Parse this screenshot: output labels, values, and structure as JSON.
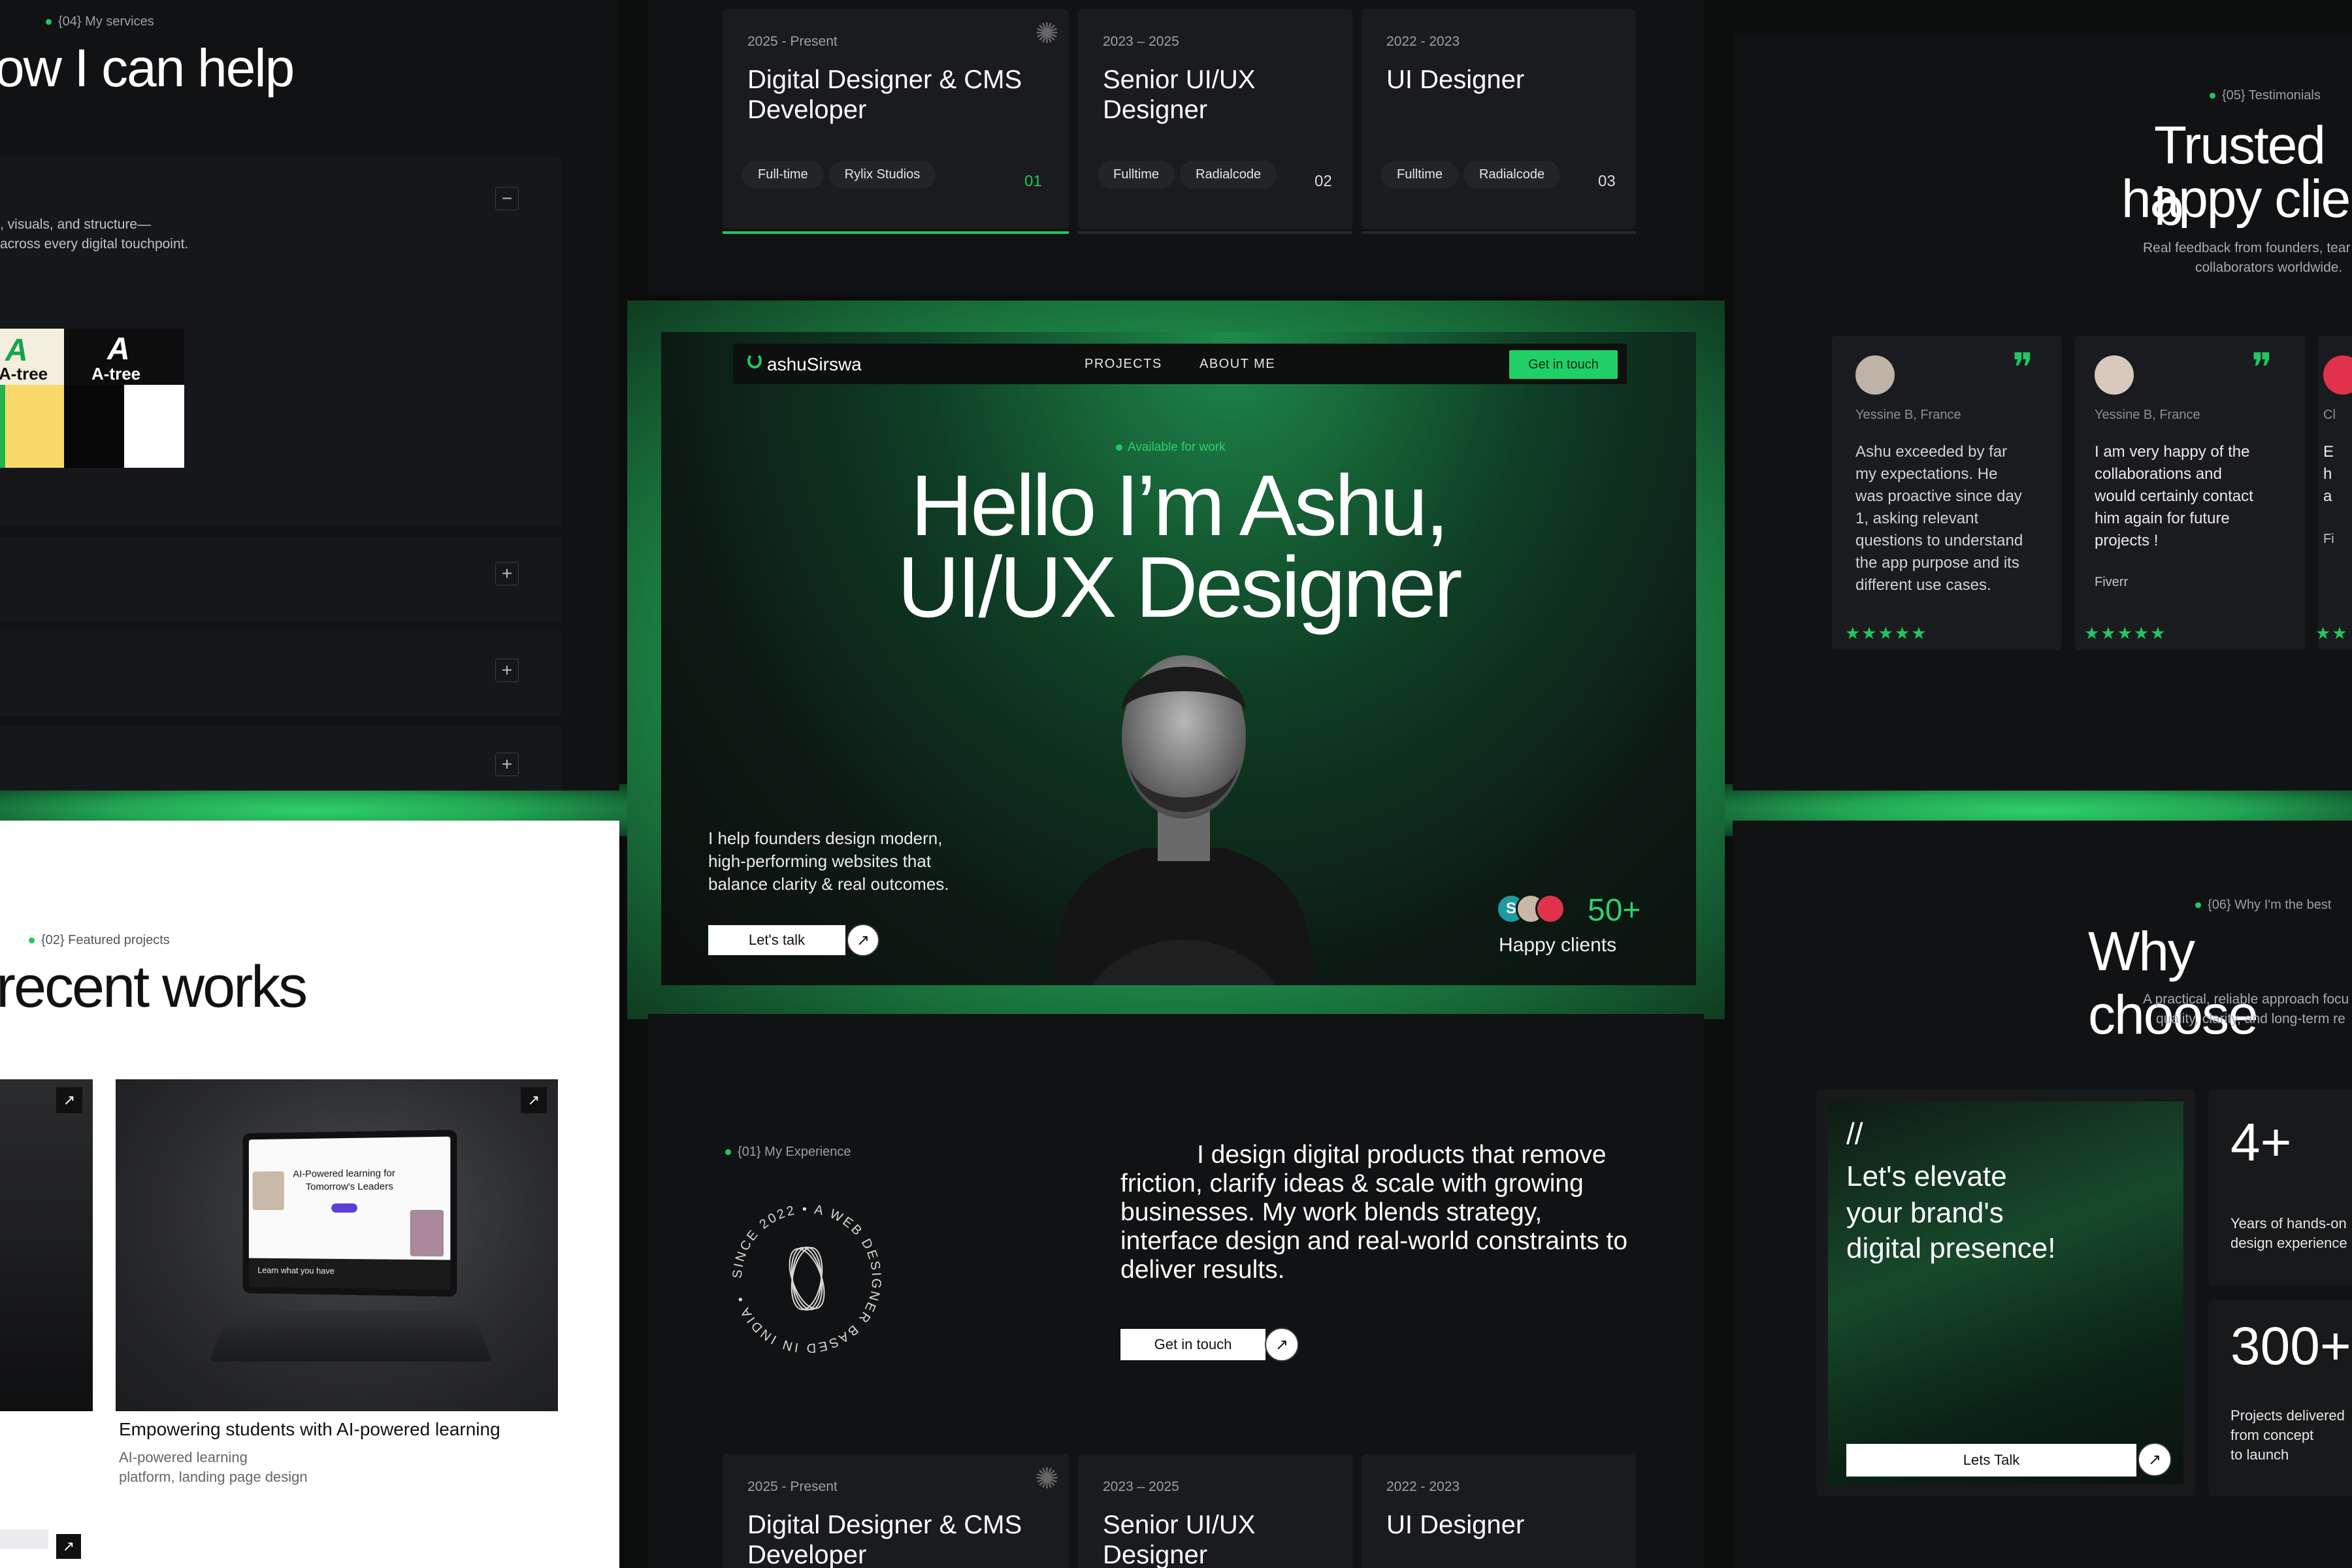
{
  "services": {
    "tag": "{04} My services",
    "title": "ow I can help",
    "desc_line1": ", visuals, and structure—",
    "desc_line2": "across every digital touchpoint.",
    "minus": "−",
    "plus": "+",
    "logo_a_label": "A-tree",
    "logo_b_label": "A-tree"
  },
  "experience_top": [
    {
      "period": "2025 - Present",
      "title_l1": "Digital Designer & CMS",
      "title_l2": "Developer",
      "chip1": "Full-time",
      "chip2": "Rylix Studios",
      "num": "01"
    },
    {
      "period": "2023 – 2025",
      "title_l1": "Senior UI/UX",
      "title_l2": "Designer",
      "chip1": "Fulltime",
      "chip2": "Radialcode",
      "num": "02"
    },
    {
      "period": "2022 - 2023",
      "title_l1": "UI Designer",
      "title_l2": "",
      "chip1": "Fulltime",
      "chip2": "Radialcode",
      "num": "03"
    }
  ],
  "experience_bottom": [
    {
      "period": "2025 - Present",
      "title_l1": "Digital Designer & CMS",
      "title_l2": "Developer"
    },
    {
      "period": "2023 – 2025",
      "title_l1": "Senior UI/UX",
      "title_l2": "Designer"
    },
    {
      "period": "2022 - 2023",
      "title_l1": "UI Designer",
      "title_l2": ""
    }
  ],
  "hero": {
    "brand": "ashuSirswa",
    "nav_projects": "PROJECTS",
    "nav_about": "ABOUT ME",
    "cta": "Get in touch",
    "available": "Available for work",
    "title_l1": "Hello I’m Ashu,",
    "title_l2": "UI/UX Designer",
    "intro_l1": "I help founders design modern,",
    "intro_l2": "high-performing websites that",
    "intro_l3": "balance clarity & real outcomes.",
    "talk": "Let's talk",
    "clients_count": "50+",
    "clients_label": "Happy clients",
    "avatar_s": "S"
  },
  "about": {
    "tag": "{01} My Experience",
    "badge_text": "SINCE 2022 • A WEB DESIGNER BASED IN INDIA •",
    "para_l1": "I design digital products that remove",
    "para_l2": "friction, clarify ideas & scale with growing",
    "para_l3": "businesses. My work blends strategy,",
    "para_l4": "interface design and real-world constraints to",
    "para_l5": "deliver results.",
    "cta": "Get in touch"
  },
  "testimonials": {
    "tag": "{05} Testimonials",
    "title_l1": "Trusted b",
    "title_l2": "happy clie",
    "sub_l1": "Real feedback from founders, tear",
    "sub_l2": "collaborators worldwide.",
    "cards": [
      {
        "name": "Yessine B, France",
        "l1": "Ashu exceeded by far",
        "l2": "my expectations. He",
        "l3": "was proactive since day",
        "l4": "1, asking relevant",
        "l5": "questions to understand",
        "l6": "the app purpose and its",
        "l7": "different use cases.",
        "source": "",
        "stars": "★★★★★"
      },
      {
        "name": "Yessine B, France",
        "l1": "I am very happy of the",
        "l2": "collaborations and",
        "l3": "would certainly contact",
        "l4": "him again for future",
        "l5": "projects !",
        "l6": "",
        "l7": "",
        "source": "Fiverr",
        "stars": "★★★★★"
      },
      {
        "name": "Cl",
        "l1": "E",
        "l2": "h",
        "l3": "a",
        "l4": "",
        "l5": "",
        "l6": "",
        "l7": "",
        "source": "Fi",
        "stars": "★★"
      }
    ],
    "quote": "❞"
  },
  "projects": {
    "tag": "{02} Featured projects",
    "title": "recent works",
    "card_title": "Empowering students with AI-powered learning",
    "card_sub_l1": "AI-powered learning",
    "card_sub_l2": "platform, landing page design",
    "mock_headline_l1": "AI-Powered learning for",
    "mock_headline_l2": "Tomorrow's Leaders",
    "mock_footer": "Learn what you have",
    "arrow": "↗"
  },
  "why": {
    "tag": "{06} Why I'm the best",
    "title": "Why choose",
    "sub_l1": "A practical, reliable approach focu",
    "sub_l2": "quality, clarity, and long-term re",
    "cta_slashes": "//",
    "cta_l1": "Let's elevate",
    "cta_l2": "your brand's",
    "cta_l3": "digital presence!",
    "cta_btn": "Lets Talk",
    "stat1_num": "4+",
    "stat1_l1": "Years of hands-on",
    "stat1_l2": "design experience",
    "stat2_num": "300+",
    "stat2_l1": "Projects delivered",
    "stat2_l2": "from concept",
    "stat2_l3": "to launch"
  },
  "colors": {
    "accent": "#20c760",
    "bg": "#0b0c0c",
    "panel": "#111214"
  }
}
